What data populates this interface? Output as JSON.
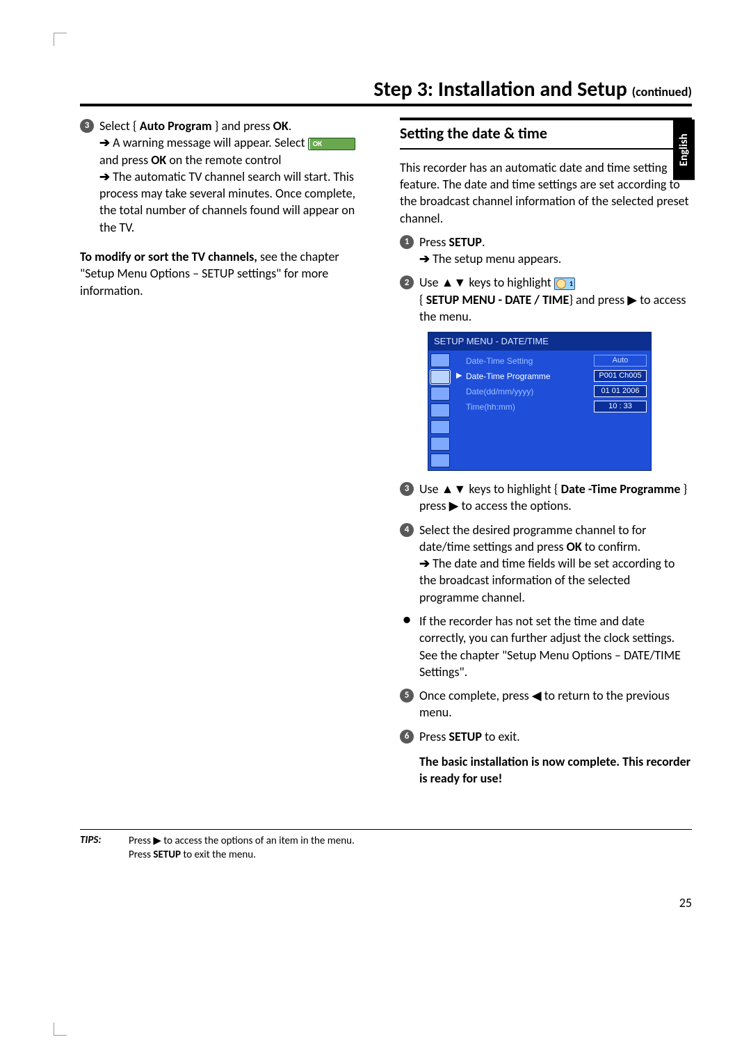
{
  "title_main": "Step 3: Installation and Setup ",
  "title_cont": "(continued)",
  "language_tab": "English",
  "page_number": "25",
  "left": {
    "s3_a": "Select { ",
    "s3_bold1": "Auto Program",
    "s3_b": " } and press ",
    "s3_bold2": "OK",
    "s3_c": ".",
    "arrow1a": "A warning message will appear. Select ",
    "ok_label": "OK",
    "arrow1b": " and press ",
    "arrow1_bold": "OK",
    "arrow1c": " on the remote control",
    "arrow2": "The automatic TV channel search will start. This process may take several minutes. Once complete, the total number of channels found will appear on the TV.",
    "modify_bold": "To modify or sort the TV channels,",
    "modify_rest": " see the chapter \"Setup Menu Options – SETUP settings\" for more information."
  },
  "right": {
    "section_title": "Setting the date & time",
    "intro": "This recorder has an automatic date and time setting feature. The date and time settings are set according to the broadcast channel information of the selected preset channel.",
    "s1_a": "Press ",
    "s1_bold": "SETUP",
    "s1_b": ".",
    "s1_arrow": "The setup menu appears.",
    "s2_a": "Use ▲▼ keys to highlight ",
    "s2_b": " { ",
    "s2_bold": "SETUP MENU - DATE / TIME",
    "s2_c": "} and press ▶ to access the menu.",
    "s3_a": "Use ▲▼ keys to highlight { ",
    "s3_bold": "Date -Time Programme",
    "s3_b": " } press ▶ to access the options.",
    "s4_a": "Select the desired programme channel to for date/time settings and press ",
    "s4_bold": "OK",
    "s4_b": " to confirm.",
    "s4_arrow": "The date and time fields will be set according to the broadcast information of the selected programme channel.",
    "note": "If the recorder has not set the time and date correctly, you can further adjust the clock settings. See the chapter \"Setup Menu Options – DATE/TIME Settings\".",
    "s5": "Once complete, press ◀ to return to the previous menu.",
    "s6_a": "Press ",
    "s6_bold": "SETUP",
    "s6_b": " to exit.",
    "closing": "The basic installation is now complete. This recorder is ready for use!"
  },
  "osd": {
    "title": "SETUP MENU - DATE/TIME",
    "rows": [
      {
        "label": "Date-Time Setting",
        "value": "Auto"
      },
      {
        "label": "Date-Time Programme",
        "value": "P001 Ch005"
      },
      {
        "label": "Date(dd/mm/yyyy)",
        "value": "01 01  2006"
      },
      {
        "label": "Time(hh:mm)",
        "value": "10 : 33"
      }
    ]
  },
  "tips": {
    "label": "TIPS:",
    "line1": "Press ▶ to access the options of an item in the menu.",
    "line2a": "Press ",
    "line2bold": "SETUP",
    "line2b": " to exit the menu."
  }
}
